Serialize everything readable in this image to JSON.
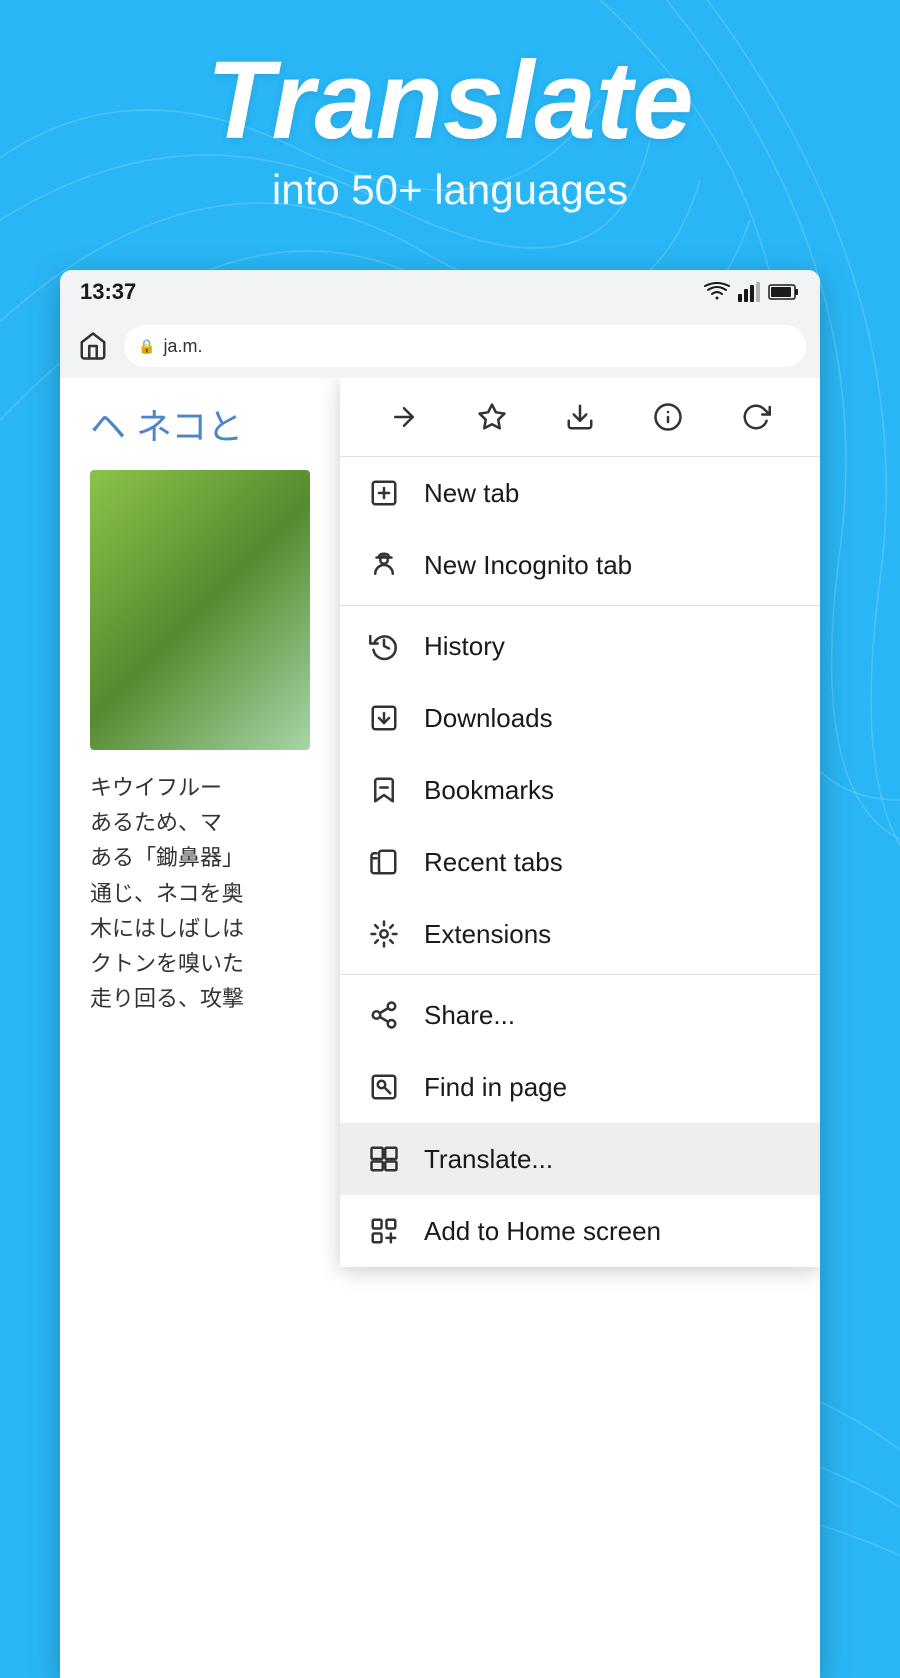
{
  "hero": {
    "title": "Translate",
    "subtitle": "into 50+ languages"
  },
  "status_bar": {
    "time": "13:37"
  },
  "address_bar": {
    "url": "ja.m."
  },
  "page": {
    "heading": "ヘ ネコと",
    "text_1": "キウイフルー",
    "text_2": "あるため、マ",
    "text_3": "ある「鋤鼻器」",
    "text_4": "通じ、ネコを奥",
    "text_5": "木にはしばしは",
    "text_6": "クトンを嗅いた",
    "text_7": "走り回る、攻撃"
  },
  "toolbar_buttons": [
    {
      "name": "forward",
      "label": "→"
    },
    {
      "name": "bookmark",
      "label": "☆"
    },
    {
      "name": "download",
      "label": "⬇"
    },
    {
      "name": "info",
      "label": "ⓘ"
    },
    {
      "name": "refresh",
      "label": "↻"
    }
  ],
  "menu_items": [
    {
      "id": "new-tab",
      "label": "New tab",
      "icon": "new-tab-icon",
      "divider_after": false
    },
    {
      "id": "new-incognito-tab",
      "label": "New Incognito tab",
      "icon": "incognito-icon",
      "divider_after": true
    },
    {
      "id": "history",
      "label": "History",
      "icon": "history-icon",
      "divider_after": false
    },
    {
      "id": "downloads",
      "label": "Downloads",
      "icon": "downloads-icon",
      "divider_after": false
    },
    {
      "id": "bookmarks",
      "label": "Bookmarks",
      "icon": "bookmarks-icon",
      "divider_after": false
    },
    {
      "id": "recent-tabs",
      "label": "Recent tabs",
      "icon": "recent-tabs-icon",
      "divider_after": false
    },
    {
      "id": "extensions",
      "label": "Extensions",
      "icon": "extensions-icon",
      "divider_after": true
    },
    {
      "id": "share",
      "label": "Share...",
      "icon": "share-icon",
      "divider_after": false
    },
    {
      "id": "find-in-page",
      "label": "Find in page",
      "icon": "find-icon",
      "divider_after": false
    },
    {
      "id": "translate",
      "label": "Translate...",
      "icon": "translate-icon",
      "highlighted": true,
      "divider_after": false
    },
    {
      "id": "add-home",
      "label": "Add to Home screen",
      "icon": "add-home-icon",
      "divider_after": false
    }
  ]
}
